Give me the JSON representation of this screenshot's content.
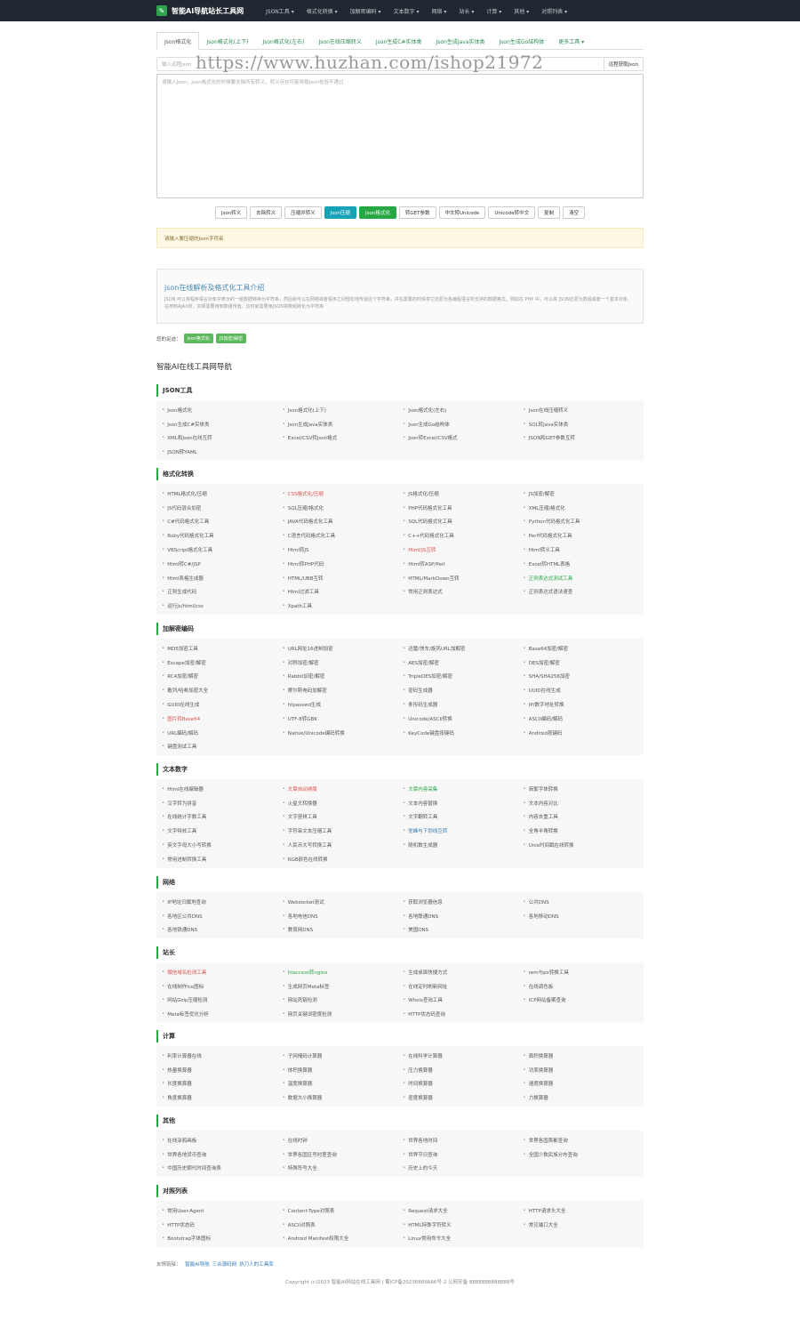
{
  "header": {
    "brand": "智能AI导航站长工具网",
    "nav": [
      "JSON工具 ▾",
      "格式化转换 ▾",
      "加解密编码 ▾",
      "文本数字 ▾",
      "网络 ▾",
      "站长 ▾",
      "计算 ▾",
      "其他 ▾",
      "对照列表 ▾"
    ]
  },
  "tabs": [
    "Json格式化",
    "Json格式化(上下)",
    "Json格式化(左右)",
    "Json在线压缩转义",
    "Json生成C#实体类",
    "Json生成Java实体类",
    "Json生成Go结构体",
    "更多工具 ▾"
  ],
  "url_input": {
    "placeholder": "输入远程Json",
    "button": "远程获取Json"
  },
  "watermark": "https://www.huzhan.com/ishop21972",
  "editor": {
    "placeholder": "请输入Json，Json格式化的时候要去除所有转义，转义存在可能导致Json校验不通过"
  },
  "buttons": [
    "Json转义",
    "去除转义",
    "压缩并转义",
    "Json压缩",
    "Json格式化",
    "转GET参数",
    "中文转Unicode",
    "Unicode转中文",
    "复制",
    "清空"
  ],
  "alert": "请输入要压缩的Json字符串",
  "intro": {
    "title": "json在线解析及格式化工具介绍",
    "text": "JSON 可以将程序语言对象中表示的一组数据转换为字符串，然后就可以在网络或者程序之间轻松地传递这个字符串，并在需要的时候将它还原为各编程语言所支持的数据格式，例如在 PHP 中，可以将 JSON还原为数组或者一个基本对象。在用到AJAX时，如果需要用到数组传值，这时就需要用JSON将数组转化为字符串"
  },
  "maybe": {
    "label": "您的足迹：",
    "tags": [
      "Json格式化",
      "JS加密/解密"
    ]
  },
  "nav_title": "智能AI在线工具网导航",
  "sections": [
    {
      "title": "JSON工具",
      "items": [
        "Json格式化",
        "Json格式化(上下)",
        "Json格式化(左右)",
        "Json在线压缩转义",
        "Json生成C#实体类",
        "Json生成Java实体类",
        "Json生成Go结构体",
        "SQL转Java实体类",
        "XML和Json在线互转",
        "Excel/CSV转Json格式",
        "Json转Excel/CSV格式",
        "JSON和GET参数互转",
        "JSON转YAML"
      ]
    },
    {
      "title": "格式化转换",
      "items": [
        "HTML格式化/压缩",
        "CSS格式化/压缩",
        "JS格式化/压缩",
        "JS加密/解密",
        "JS代码混合加密",
        "SQL压缩/格式化",
        "PHP代码格式化工具",
        "XML压缩/格式化",
        "C#代码格式化工具",
        "JAVA代码格式化工具",
        "SQL代码格式化工具",
        "Python代码格式化工具",
        "Ruby代码格式化工具",
        "C语言代码格式化工具",
        "C++代码格式化工具",
        "Perl代码格式化工具",
        "VBScript格式化工具",
        "Html转JS",
        "Html/JS互转",
        "Html转义工具",
        "Html转C#/JSP",
        "Html转PHP代码",
        "Html转ASP/Perl",
        "Excel转HTML表格",
        "Html表格生成器",
        "HTML/UBB互转",
        "HTML/MarkDown互转",
        "正则表达式测试工具",
        "正则生成代码",
        "Html过滤工具",
        "常用正则表达式",
        "正则表达式语法速查",
        "运行Js/html/css",
        "Xpath工具"
      ],
      "colors": {
        "1": "red",
        "18": "red",
        "27": "green"
      }
    },
    {
      "title": "加解密编码",
      "items": [
        "MD5加密工具",
        "URL网址16进制加密",
        "迅雷/快车/旋风URL加解密",
        "Base64加密/解密",
        "Escape加密/解密",
        "对称加密/解密",
        "AES加密/解密",
        "DES加密/解密",
        "RC4加密/解密",
        "Rabbit加密/解密",
        "TripleDES加密/解密",
        "SHA/SHA256加密",
        "散列/哈希加密大全",
        "摩尔斯电码加解密",
        "密码生成器",
        "UUID在线生成",
        "GUID在线生成",
        "htpasswd生成",
        "条形码生成器",
        "IP/数字地址转换",
        "图片转Base64",
        "UTF-8转GBK",
        "Unicode/ASCII转换",
        "ASCII编码/解码",
        "URL编码/解码",
        "Native/Unicode编码转换",
        "KeyCode键盘按键码",
        "Android按键码",
        "键盘测试工具"
      ],
      "colors": {
        "20": "red"
      }
    },
    {
      "title": "文本数字",
      "items": [
        "Html在线编辑器",
        "文章自动排版",
        "文章内容采集",
        "简繁字体转换",
        "汉字转为拼音",
        "火星文转换器",
        "文本内容替换",
        "文本内容对比",
        "在线统计字数工具",
        "文字竖排工具",
        "文字翻转工具",
        "内容去重工具",
        "文字特效工具",
        "字符串文本压缩工具",
        "驼峰与下划线互转",
        "全角半角转换",
        "英文字母大小写转换",
        "人民币大写转换工具",
        "随机数生成器",
        "Unix时间戳在线转换",
        "常用进制转换工具",
        "RGB颜色在线转换"
      ],
      "colors": {
        "1": "red",
        "2": "green",
        "14": "blue"
      }
    },
    {
      "title": "网络",
      "items": [
        "IP地址归属地查询",
        "Websocket测试",
        "获取浏览器信息",
        "公共DNS",
        "各地区公共DNS",
        "各地电信DNS",
        "各地联通DNS",
        "各地移动DNS",
        "各地铁通DNS",
        "教育网DNS",
        "美国DNS"
      ]
    },
    {
      "title": "站长",
      "items": [
        "微信域名检测工具",
        "htaccess转nginx",
        "生成桌面快捷方式",
        "rem与px转换工具",
        "在线制作ico图标",
        "生成网页Meta标签",
        "在线定时刷新网址",
        "在线调色板",
        "网站Gzip压缩检测",
        "网站死链检测",
        "Whois查询工具",
        "ICP网站备案查询",
        "Meta标签优化分析",
        "网页关键词密度检测",
        "HTTP状态码查询"
      ],
      "colors": {
        "0": "red",
        "1": "green"
      }
    },
    {
      "title": "计算",
      "items": [
        "利率计算器在线",
        "子网掩码计算器",
        "在线科学计算器",
        "面积换算器",
        "热量换算器",
        "体积换算器",
        "压力换算器",
        "功率换算器",
        "长度换算器",
        "温度换算器",
        "时间换算器",
        "速度换算器",
        "角度换算器",
        "数据大小换算器",
        "密度换算器",
        "力换算器"
      ]
    },
    {
      "title": "其他",
      "items": [
        "在线涂鸦画板",
        "在线时钟",
        "世界各地时间",
        "世界各国首都查询",
        "世界各地货币查询",
        "世界各国区号时差查询",
        "世界节日查询",
        "全国少数民族分布查询",
        "中国历史朝代时间查询表",
        "特殊符号大全",
        "历史上的今天"
      ]
    },
    {
      "title": "对照列表",
      "items": [
        "常用User-Agent",
        "Content-Type对照表",
        "Request请求大全",
        "HTTP请求头大全",
        "HTTP状态码",
        "ASCII对照表",
        "HTML特殊字符转义",
        "常见端口大全",
        "Bootstrap字体图标",
        "Android Manifest权限大全",
        "Linux常用命令大全"
      ]
    }
  ],
  "friends": {
    "label": "友情链接：",
    "links": [
      "智能AI导航",
      "三合源码网",
      "执刀人的工具库"
    ]
  },
  "footer": "Copyright (c)2023 智能AI网站在线工具网 | 蜀ICP备20236666666号-2 公网安备 8888888888888号"
}
